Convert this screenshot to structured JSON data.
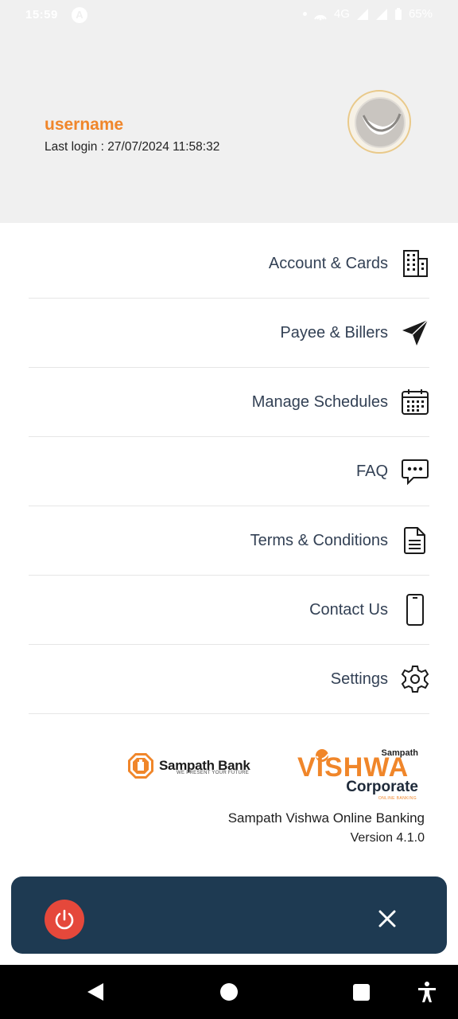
{
  "status_bar": {
    "time": "15:59",
    "notification_badge": "A",
    "network": "4G",
    "battery": "65%"
  },
  "header": {
    "username": "username",
    "last_login": "Last login : 27/07/2024 11:58:32"
  },
  "menu": {
    "items": [
      {
        "label": "Account & Cards",
        "icon": "building-icon"
      },
      {
        "label": "Payee & Billers",
        "icon": "send-icon"
      },
      {
        "label": "Manage Schedules",
        "icon": "calendar-icon"
      },
      {
        "label": "FAQ",
        "icon": "chat-icon"
      },
      {
        "label": "Terms & Conditions",
        "icon": "document-icon"
      },
      {
        "label": "Contact Us",
        "icon": "phone-icon"
      },
      {
        "label": "Settings",
        "icon": "gear-icon"
      }
    ]
  },
  "branding": {
    "sampath_bank": "Sampath Bank",
    "sampath_tagline": "WE PRESENT YOUR FUTURE",
    "vishwa_sampath": "Sampath",
    "vishwa_word": "VISHWA",
    "vishwa_corporate": "Corporate",
    "vishwa_online": "ONLINE BANKING",
    "app_name": "Sampath Vishwa Online Banking",
    "version": "Version 4.1.0"
  },
  "colors": {
    "accent": "#f0862a",
    "panel": "#1e3a52",
    "power": "#e5483b"
  }
}
